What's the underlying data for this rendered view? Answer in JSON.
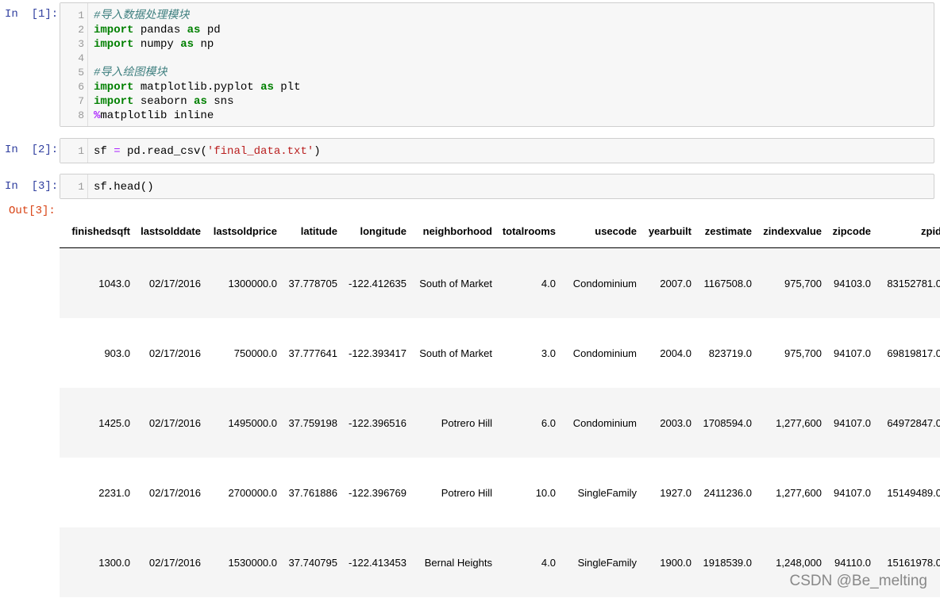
{
  "cells": [
    {
      "prompt": "In  [1]:",
      "lines": [
        {
          "n": "1",
          "parts": [
            {
              "t": "#导入数据处理模块",
              "c": "cm"
            }
          ]
        },
        {
          "n": "2",
          "parts": [
            {
              "t": "import",
              "c": "kw"
            },
            {
              "t": " pandas ",
              "c": "nm"
            },
            {
              "t": "as",
              "c": "kw"
            },
            {
              "t": " pd",
              "c": "nm"
            }
          ]
        },
        {
          "n": "3",
          "parts": [
            {
              "t": "import",
              "c": "kw"
            },
            {
              "t": " numpy ",
              "c": "nm"
            },
            {
              "t": "as",
              "c": "kw"
            },
            {
              "t": " np",
              "c": "nm"
            }
          ]
        },
        {
          "n": "4",
          "parts": []
        },
        {
          "n": "5",
          "parts": [
            {
              "t": "#导入绘图模块",
              "c": "cm"
            }
          ]
        },
        {
          "n": "6",
          "parts": [
            {
              "t": "import",
              "c": "kw"
            },
            {
              "t": " matplotlib.pyplot ",
              "c": "nm"
            },
            {
              "t": "as",
              "c": "kw"
            },
            {
              "t": " plt",
              "c": "nm"
            }
          ]
        },
        {
          "n": "7",
          "parts": [
            {
              "t": "import",
              "c": "kw"
            },
            {
              "t": " seaborn ",
              "c": "nm"
            },
            {
              "t": "as",
              "c": "kw"
            },
            {
              "t": " sns",
              "c": "nm"
            }
          ]
        },
        {
          "n": "8",
          "parts": [
            {
              "t": "%",
              "c": "mg"
            },
            {
              "t": "matplotlib inline",
              "c": "nm"
            }
          ]
        }
      ]
    },
    {
      "prompt": "In  [2]:",
      "lines": [
        {
          "n": "1",
          "parts": [
            {
              "t": "sf ",
              "c": "nm"
            },
            {
              "t": "=",
              "c": "op"
            },
            {
              "t": " pd.read_csv(",
              "c": "nm"
            },
            {
              "t": "'final_data.txt'",
              "c": "str"
            },
            {
              "t": ")",
              "c": "nm"
            }
          ]
        }
      ]
    },
    {
      "prompt": "In  [3]:",
      "lines": [
        {
          "n": "1",
          "parts": [
            {
              "t": "sf.head()",
              "c": "nm"
            }
          ]
        }
      ]
    }
  ],
  "output": {
    "prompt": "Out[3]:",
    "columns": [
      "finishedsqft",
      "lastsolddate",
      "lastsoldprice",
      "latitude",
      "longitude",
      "neighborhood",
      "totalrooms",
      "usecode",
      "yearbuilt",
      "zestimate",
      "zindexvalue",
      "zipcode",
      "zpid"
    ],
    "rows": [
      [
        "1043.0",
        "02/17/2016",
        "1300000.0",
        "37.778705",
        "-122.412635",
        "South of Market",
        "4.0",
        "Condominium",
        "2007.0",
        "1167508.0",
        "975,700",
        "94103.0",
        "83152781.0"
      ],
      [
        "903.0",
        "02/17/2016",
        "750000.0",
        "37.777641",
        "-122.393417",
        "South of Market",
        "3.0",
        "Condominium",
        "2004.0",
        "823719.0",
        "975,700",
        "94107.0",
        "69819817.0"
      ],
      [
        "1425.0",
        "02/17/2016",
        "1495000.0",
        "37.759198",
        "-122.396516",
        "Potrero Hill",
        "6.0",
        "Condominium",
        "2003.0",
        "1708594.0",
        "1,277,600",
        "94107.0",
        "64972847.0"
      ],
      [
        "2231.0",
        "02/17/2016",
        "2700000.0",
        "37.761886",
        "-122.396769",
        "Potrero Hill",
        "10.0",
        "SingleFamily",
        "1927.0",
        "2411236.0",
        "1,277,600",
        "94107.0",
        "15149489.0"
      ],
      [
        "1300.0",
        "02/17/2016",
        "1530000.0",
        "37.740795",
        "-122.413453",
        "Bernal Heights",
        "4.0",
        "SingleFamily",
        "1900.0",
        "1918539.0",
        "1,248,000",
        "94110.0",
        "15161978.0"
      ]
    ]
  },
  "watermark": "CSDN @Be_melting"
}
